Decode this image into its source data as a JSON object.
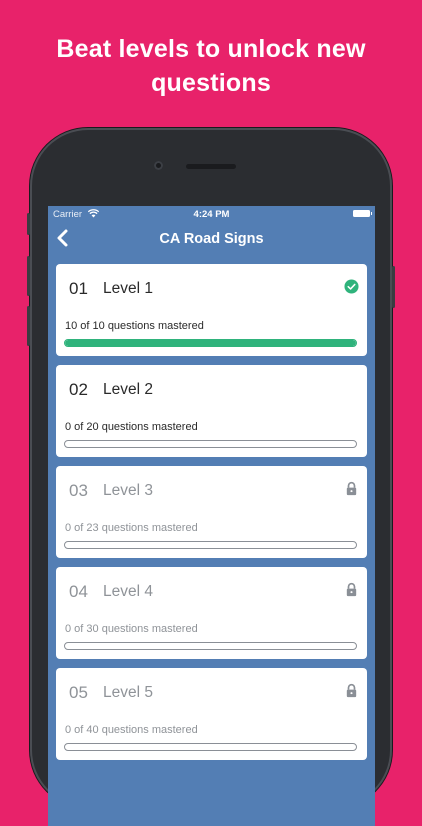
{
  "headline": {
    "line1": "Beat levels to unlock new",
    "line2": "questions"
  },
  "status_bar": {
    "carrier": "Carrier",
    "time": "4:24 PM",
    "wifi_icon": "wifi-icon",
    "battery_icon": "battery-icon"
  },
  "nav": {
    "title": "CA Road Signs",
    "back_icon": "chevron-left-icon"
  },
  "colors": {
    "background": "#E8226A",
    "screen": "#537EB4",
    "progress": "#2FB37C",
    "locked_text": "#8f9398"
  },
  "levels": [
    {
      "number": "01",
      "name": "Level 1",
      "progress_text": "10 of 10 questions mastered",
      "mastered": 10,
      "total": 10,
      "state": "completed",
      "icon": "check-circle-icon"
    },
    {
      "number": "02",
      "name": "Level 2",
      "progress_text": "0 of 20 questions mastered",
      "mastered": 0,
      "total": 20,
      "state": "unlocked",
      "icon": ""
    },
    {
      "number": "03",
      "name": "Level 3",
      "progress_text": "0 of 23 questions mastered",
      "mastered": 0,
      "total": 23,
      "state": "locked",
      "icon": "lock-icon"
    },
    {
      "number": "04",
      "name": "Level 4",
      "progress_text": "0 of 30 questions mastered",
      "mastered": 0,
      "total": 30,
      "state": "locked",
      "icon": "lock-icon"
    },
    {
      "number": "05",
      "name": "Level 5",
      "progress_text": "0 of 40 questions mastered",
      "mastered": 0,
      "total": 40,
      "state": "locked",
      "icon": "lock-icon"
    }
  ]
}
